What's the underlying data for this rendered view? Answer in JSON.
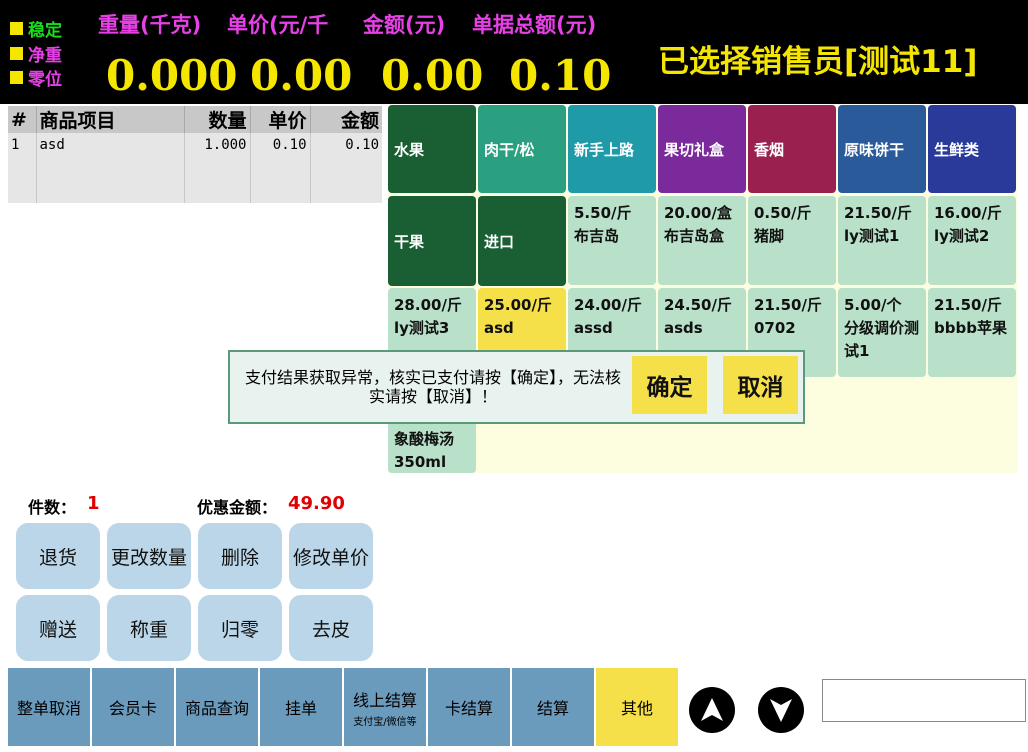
{
  "status": {
    "stable": "稳定",
    "net": "净重",
    "zero": "零位"
  },
  "metrics": {
    "weight_label": "重量(千克)",
    "unit_price_label": "单价(元/千",
    "amount_label": "金额(元)",
    "total_label": "单据总额(元)",
    "weight_value": "0.000",
    "unit_price_value": "0.00",
    "amount_value": "0.00",
    "total_value": "0.10"
  },
  "salesperson": "已选择销售员[测试11]",
  "order": {
    "headers": [
      "#",
      "商品项目",
      "数量",
      "单价",
      "金额"
    ],
    "rows": [
      {
        "idx": "1",
        "name": "asd",
        "qty": "1.000",
        "price": "0.10",
        "amount": "0.10"
      }
    ]
  },
  "categories": [
    {
      "label": "水果",
      "color": "#1a5e33"
    },
    {
      "label": "肉干/松",
      "color": "#2aa080"
    },
    {
      "label": "新手上路",
      "color": "#1e9aa8"
    },
    {
      "label": "果切礼盒",
      "color": "#7a2a9a"
    },
    {
      "label": "香烟",
      "color": "#9a2050"
    },
    {
      "label": "原味饼干",
      "color": "#2a5a9a"
    },
    {
      "label": "生鲜类",
      "color": "#2a3a9a"
    },
    {
      "label": "干果",
      "color": "#1a5e33"
    },
    {
      "label": "进口",
      "color": "#1a5e33"
    }
  ],
  "products": [
    {
      "price": "5.50/斤",
      "name": "布吉岛"
    },
    {
      "price": "20.00/盒",
      "name": "布吉岛盒"
    },
    {
      "price": "0.50/斤",
      "name": "猪脚"
    },
    {
      "price": "21.50/斤",
      "name": "ly测试1"
    },
    {
      "price": "16.00/斤",
      "name": "ly测试2"
    },
    {
      "price": "28.00/斤",
      "name": "ly测试3"
    },
    {
      "price": "25.00/斤",
      "name": "asd"
    },
    {
      "price": "24.00/斤",
      "name": "assd"
    },
    {
      "price": "24.50/斤",
      "name": "asds"
    },
    {
      "price": "21.50/斤",
      "name": "0702"
    },
    {
      "price": "5.00/个",
      "name": "分级调价测试1"
    },
    {
      "price": "21.50/斤",
      "name": "bbbb苹果"
    },
    {
      "price": "",
      "name": "象酸梅汤350ml"
    }
  ],
  "summary": {
    "count_label": "件数：",
    "count_value": "1",
    "discount_label": "优惠金额：",
    "discount_value": "49.90"
  },
  "actions": [
    "退货",
    "更改数量",
    "删除",
    "修改单价",
    "赠送",
    "称重",
    "归零",
    "去皮"
  ],
  "toolbar": {
    "cancel_all": "整单取消",
    "member_card": "会员卡",
    "product_query": "商品查询",
    "hang": "挂单",
    "online_pay": "线上结算",
    "online_pay_sub": "支付宝/微信等",
    "card_pay": "卡结算",
    "checkout": "结算",
    "other": "其他"
  },
  "dialog": {
    "message": "支付结果获取异常，核实已支付请按【确定】，无法核实请按【取消】！",
    "confirm": "确定",
    "cancel": "取消"
  }
}
